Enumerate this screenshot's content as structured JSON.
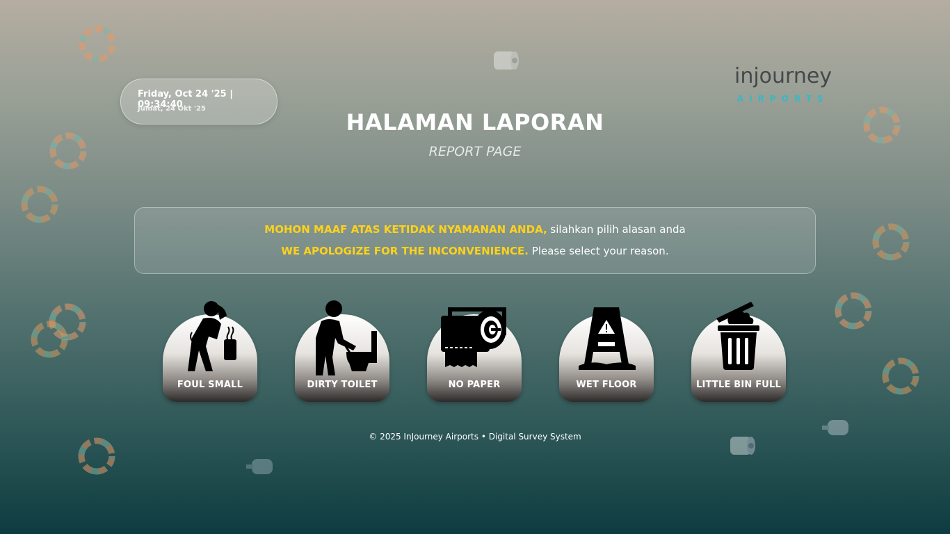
{
  "datetime": {
    "main": "Friday, Oct 24 '25 | 09:34:40",
    "sub": "Jumat, 24 Okt '25"
  },
  "brand": {
    "wordmark": "injourney",
    "sub": "AIRPORTS"
  },
  "header": {
    "title": "HALAMAN LAPORAN",
    "subtitle": "REPORT PAGE"
  },
  "notice": {
    "id_highlight": "MOHON MAAF ATAS KETIDAK NYAMANAN ANDA,",
    "id_text": " silahkan pilih alasan anda",
    "en_highlight": "WE APOLOGIZE FOR THE INCONVENIENCE.",
    "en_text": " Please select your reason."
  },
  "reasons": [
    {
      "label": "FOUL SMALL",
      "icon": "foul-smell-icon"
    },
    {
      "label": "DIRTY TOILET",
      "icon": "dirty-toilet-icon"
    },
    {
      "label": "NO PAPER",
      "icon": "toilet-paper-icon"
    },
    {
      "label": "WET FLOOR",
      "icon": "wet-floor-sign-icon"
    },
    {
      "label": "LITTLE BIN FULL",
      "icon": "trash-bin-icon"
    }
  ],
  "footer": {
    "text": "© 2025 InJourney Airports  •  Digital Survey System"
  },
  "colors": {
    "highlight": "#ffd21a",
    "bg_top": "#b5ada1",
    "bg_bottom": "#0d3c40",
    "brand_teal": "#38b8c7"
  }
}
